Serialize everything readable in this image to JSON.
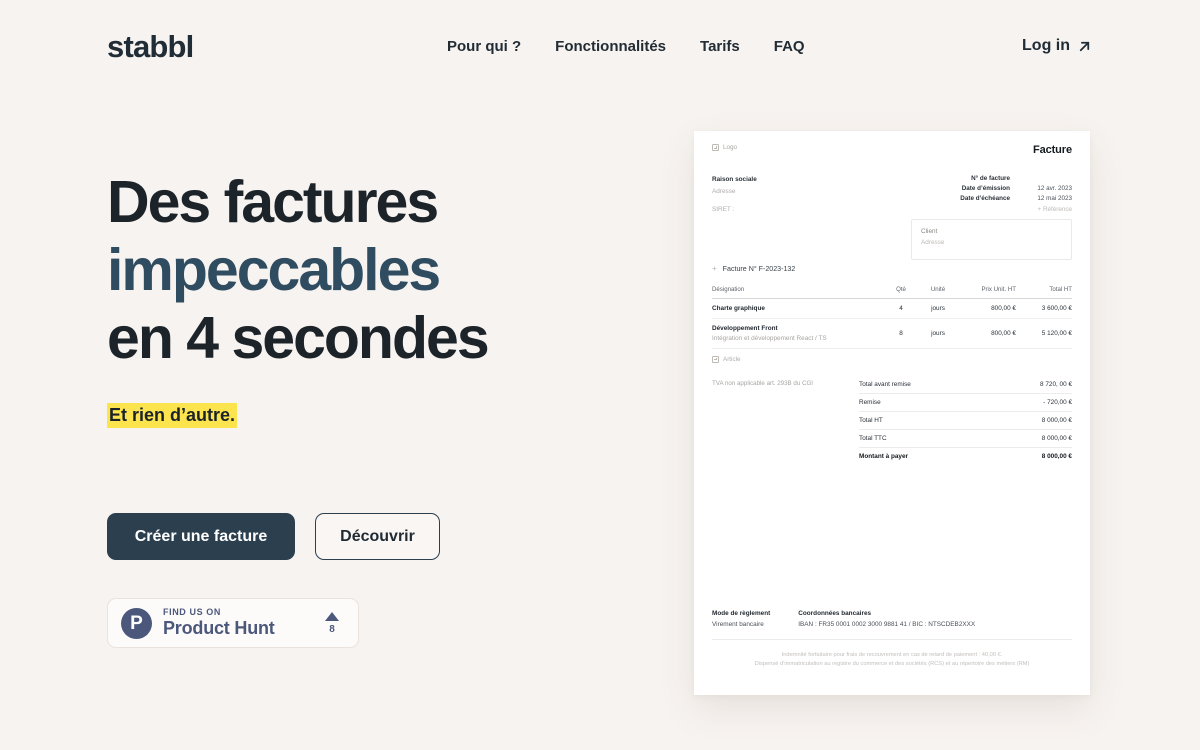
{
  "brand": "stabbl",
  "nav": {
    "links": [
      {
        "label": "Pour qui ?"
      },
      {
        "label": "Fonctionnalités"
      },
      {
        "label": "Tarifs"
      },
      {
        "label": "FAQ"
      }
    ],
    "login_label": "Log in",
    "login_icon": "arrow-up-right-icon"
  },
  "hero": {
    "headline_line1": "Des factures",
    "headline_line2": "impeccables",
    "headline_line3": "en 4 secondes",
    "subline": "Et rien d’autre.",
    "highlight_color": "#fbe44d",
    "accent_color": "#2f4c60",
    "primary_cta": "Créer une facture",
    "secondary_cta": "Découvrir"
  },
  "product_hunt": {
    "logo_letter": "P",
    "kicker": "FIND US ON",
    "name": "Product Hunt",
    "upvotes": "8",
    "brand_color": "#4b587c"
  },
  "invoice": {
    "logo_placeholder": "Logo",
    "doc_title": "Facture",
    "issuer": {
      "company": "Raison sociale",
      "address": "Adresse",
      "siret": "SIRET :"
    },
    "meta": [
      {
        "label": "N° de facture",
        "value": ""
      },
      {
        "label": "Date d’émission",
        "value": "12 avr. 2023"
      },
      {
        "label": "Date d’échéance",
        "value": "12 mai 2023"
      }
    ],
    "meta_add": "+  Référence",
    "client": {
      "title": "Client",
      "address": "Adresse"
    },
    "number_line": "Facture N° F-2023-132",
    "table_headers": {
      "designation": "Désignation",
      "qty": "Qté",
      "unit": "Unité",
      "unit_price": "Prix Unit. HT",
      "total": "Total HT"
    },
    "items": [
      {
        "name": "Charte graphique",
        "sub": "",
        "qty": "4",
        "unit": "jours",
        "unit_price": "800,00 €",
        "total": "3 600,00 €"
      },
      {
        "name": "Développement Front",
        "sub": "Intégration et développement React / TS",
        "qty": "8",
        "unit": "jours",
        "unit_price": "800,00 €",
        "total": "5 120,00 €"
      }
    ],
    "add_article": "Article",
    "tva_note": "TVA non applicable art. 293B du CGI",
    "totals": [
      {
        "label": "Total avant remise",
        "value": "8 720, 00 €"
      },
      {
        "label": "Remise",
        "value": "- 720,00 €"
      },
      {
        "label": "Total HT",
        "value": "8 000,00 €"
      },
      {
        "label": "Total TTC",
        "value": "8 000,00 €"
      },
      {
        "label": "Montant à payer",
        "value": "8 000,00 €"
      }
    ],
    "payment": {
      "mode_title": "Mode de règlement",
      "mode_value": "Virement bancaire",
      "bank_title": "Coordonnées bancaires",
      "bank_value": "IBAN : FR35 0001 0002 3000 9881 41 / BIC : NTSCDEB2XXX"
    },
    "legal_line1": "Indemnité forfaitaire pour frais de recouvrement en cas de retard de paiement : 40,00 €.",
    "legal_line2": "Dispensé d’immatriculation au registre du commerce et des sociétés (RCS) et au répertoire des métiers (RM)"
  }
}
